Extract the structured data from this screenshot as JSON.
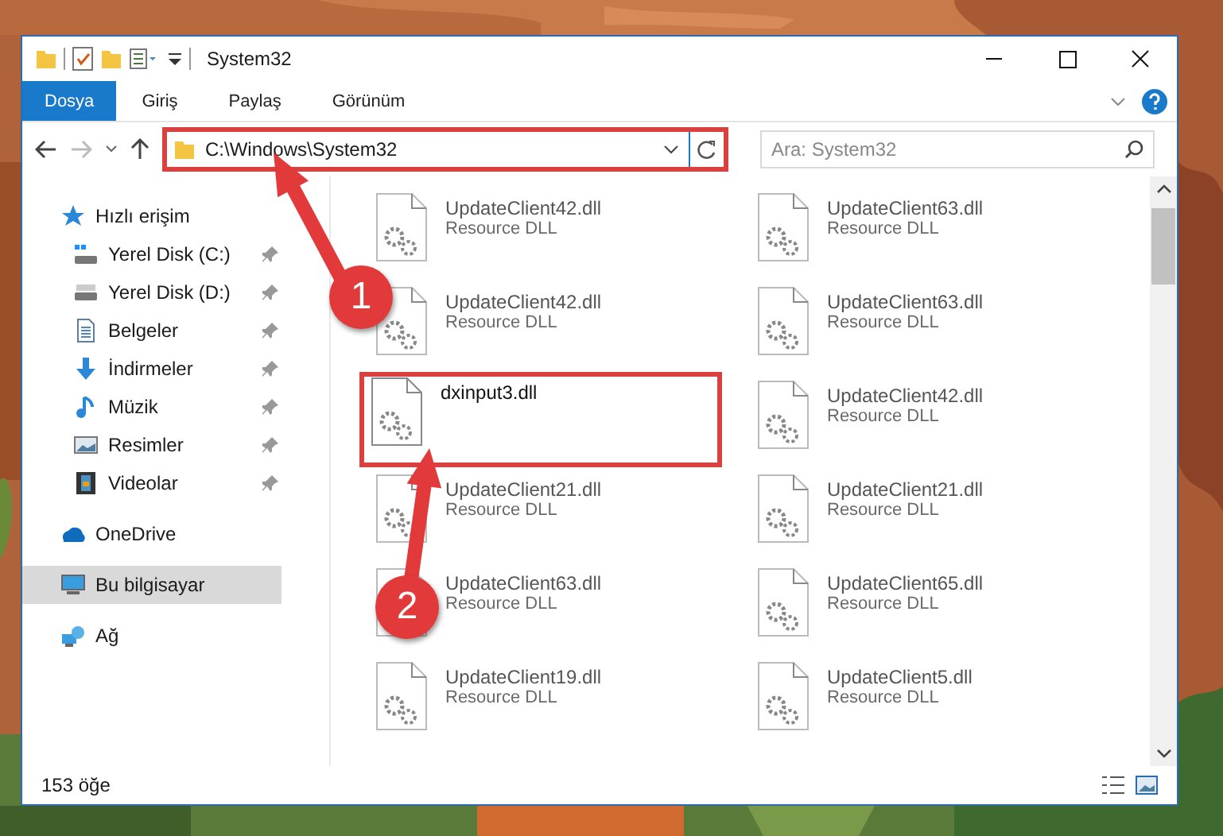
{
  "window": {
    "title": "System32"
  },
  "ribbon_tabs": [
    {
      "label": "Dosya",
      "kind": "file_menu"
    },
    {
      "label": "Giriş",
      "kind": "tab"
    },
    {
      "label": "Paylaş",
      "kind": "tab"
    },
    {
      "label": "Görünüm",
      "kind": "tab"
    }
  ],
  "address_bar": {
    "path": "C:\\Windows\\System32",
    "highlighted": true
  },
  "search": {
    "placeholder": "Ara: System32"
  },
  "sidebar": {
    "items": [
      {
        "label": "Hızlı erişim",
        "pinned": false,
        "selected": false,
        "children": [
          {
            "label": "Yerel Disk (C:)",
            "pinned": true,
            "selected": false
          },
          {
            "label": "Yerel Disk (D:)",
            "pinned": true,
            "selected": false
          },
          {
            "label": "Belgeler",
            "pinned": true,
            "selected": false
          },
          {
            "label": "İndirmeler",
            "pinned": true,
            "selected": false
          },
          {
            "label": "Müzik",
            "pinned": true,
            "selected": false
          },
          {
            "label": "Resimler",
            "pinned": true,
            "selected": false
          },
          {
            "label": "Videolar",
            "pinned": true,
            "selected": false
          }
        ]
      },
      {
        "label": "OneDrive",
        "pinned": false,
        "selected": false
      },
      {
        "label": "Bu bilgisayar",
        "pinned": false,
        "selected": true
      },
      {
        "label": "Ağ",
        "pinned": false,
        "selected": false
      }
    ]
  },
  "files": [
    {
      "name": "UpdateClient42.dll",
      "type": "Resource DLL",
      "blurred": true
    },
    {
      "name": "UpdateClient63.dll",
      "type": "Resource DLL",
      "blurred": true
    },
    {
      "name": "UpdateClient42.dll",
      "type": "Resource DLL",
      "blurred": true
    },
    {
      "name": "UpdateClient63.dll",
      "type": "Resource DLL",
      "blurred": true
    },
    {
      "name": "dxinput3.dll",
      "blurred": false,
      "highlighted": true
    },
    {
      "name": "UpdateClient42.dll",
      "type": "Resource DLL",
      "blurred": true
    },
    {
      "name": "UpdateClient21.dll",
      "type": "Resource DLL",
      "blurred": true
    },
    {
      "name": "UpdateClient21.dll",
      "type": "Resource DLL",
      "blurred": true
    },
    {
      "name": "UpdateClient63.dll",
      "type": "Resource DLL",
      "blurred": true
    },
    {
      "name": "UpdateClient65.dll",
      "type": "Resource DLL",
      "blurred": true
    },
    {
      "name": "UpdateClient19.dll",
      "type": "Resource DLL",
      "blurred": true
    },
    {
      "name": "UpdateClient5.dll",
      "type": "Resource DLL",
      "blurred": true
    }
  ],
  "status_bar": {
    "item_count": "153 öğe"
  },
  "annotations": [
    {
      "number": "1"
    },
    {
      "number": "2"
    }
  ]
}
